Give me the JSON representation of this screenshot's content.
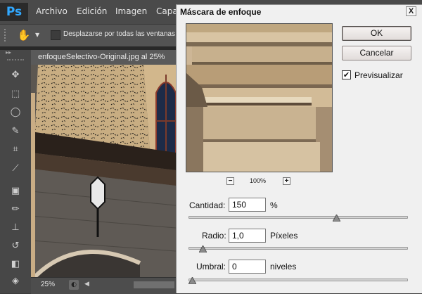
{
  "app": {
    "logo": "Ps",
    "menu": [
      "Archivo",
      "Edición",
      "Imagen",
      "Capa"
    ]
  },
  "options_bar": {
    "tool_icon": "hand-icon",
    "scroll_all_windows_label": "Desplazarse por todas las ventanas",
    "scroll_all_windows_checked": false
  },
  "toolbox": {
    "tools": [
      "move-icon",
      "marquee-icon",
      "lasso-icon",
      "quick-selection-icon",
      "crop-icon",
      "eyedropper-icon",
      "healing-brush-icon",
      "brush-icon",
      "clone-stamp-icon",
      "history-brush-icon",
      "eraser-icon",
      "paint-bucket-icon"
    ]
  },
  "document": {
    "tab_title": "enfoqueSelectivo-Original.jpg al 25%",
    "zoom": "25%"
  },
  "dialog": {
    "title": "Máscara de enfoque",
    "close_label": "X",
    "ok_label": "OK",
    "cancel_label": "Cancelar",
    "preview_label": "Previsualizar",
    "preview_checked": true,
    "preview_check_glyph": "✔",
    "zoom_out_label": "−",
    "zoom_in_label": "+",
    "preview_zoom": "100%",
    "amount": {
      "label": "Cantidad:",
      "value": "150",
      "unit": "%",
      "slider_fraction": 0.68
    },
    "radius": {
      "label": "Radio:",
      "value": "1,0",
      "unit": "Píxeles",
      "slider_fraction": 0.05
    },
    "threshold": {
      "label": "Umbral:",
      "value": "0",
      "unit": "niveles",
      "slider_fraction": 0.0
    }
  },
  "colors": {
    "ui_dark": "#4a4a4a",
    "dialog_bg": "#f0f0f0",
    "ps_accent": "#31a8ff"
  }
}
